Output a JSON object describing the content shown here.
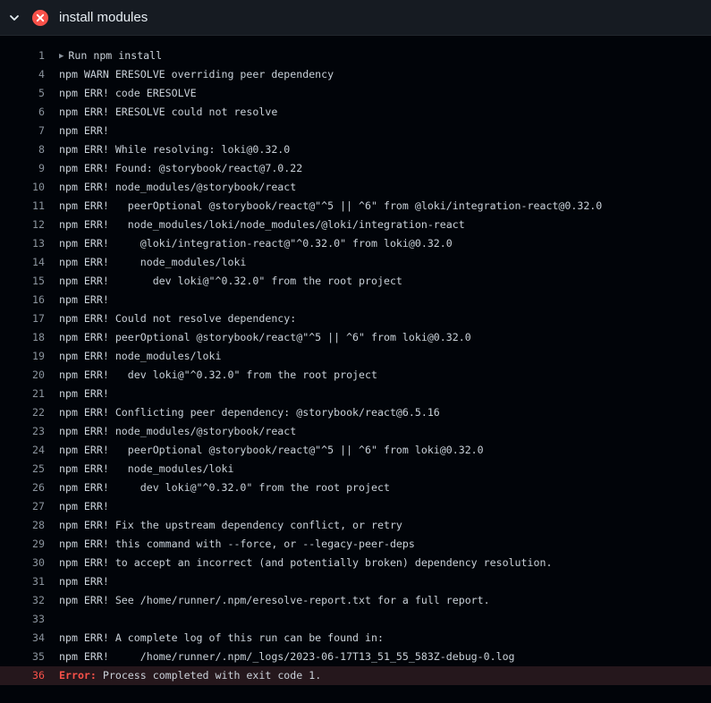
{
  "step": {
    "title": "install modules",
    "status": "failed",
    "icons": {
      "toggle": "chevron-down-icon",
      "status": "x-circle-fill-icon"
    },
    "colors": {
      "failure": "#f85149",
      "background": "#010409",
      "header": "#161b22"
    }
  },
  "log": {
    "lines": [
      {
        "num": "1",
        "text": "Run npm install",
        "group": true
      },
      {
        "num": "4",
        "text": "npm WARN ERESOLVE overriding peer dependency"
      },
      {
        "num": "5",
        "text": "npm ERR! code ERESOLVE"
      },
      {
        "num": "6",
        "text": "npm ERR! ERESOLVE could not resolve"
      },
      {
        "num": "7",
        "text": "npm ERR!"
      },
      {
        "num": "8",
        "text": "npm ERR! While resolving: loki@0.32.0"
      },
      {
        "num": "9",
        "text": "npm ERR! Found: @storybook/react@7.0.22"
      },
      {
        "num": "10",
        "text": "npm ERR! node_modules/@storybook/react"
      },
      {
        "num": "11",
        "text": "npm ERR!   peerOptional @storybook/react@\"^5 || ^6\" from @loki/integration-react@0.32.0"
      },
      {
        "num": "12",
        "text": "npm ERR!   node_modules/loki/node_modules/@loki/integration-react"
      },
      {
        "num": "13",
        "text": "npm ERR!     @loki/integration-react@\"^0.32.0\" from loki@0.32.0"
      },
      {
        "num": "14",
        "text": "npm ERR!     node_modules/loki"
      },
      {
        "num": "15",
        "text": "npm ERR!       dev loki@\"^0.32.0\" from the root project"
      },
      {
        "num": "16",
        "text": "npm ERR!"
      },
      {
        "num": "17",
        "text": "npm ERR! Could not resolve dependency:"
      },
      {
        "num": "18",
        "text": "npm ERR! peerOptional @storybook/react@\"^5 || ^6\" from loki@0.32.0"
      },
      {
        "num": "19",
        "text": "npm ERR! node_modules/loki"
      },
      {
        "num": "20",
        "text": "npm ERR!   dev loki@\"^0.32.0\" from the root project"
      },
      {
        "num": "21",
        "text": "npm ERR!"
      },
      {
        "num": "22",
        "text": "npm ERR! Conflicting peer dependency: @storybook/react@6.5.16"
      },
      {
        "num": "23",
        "text": "npm ERR! node_modules/@storybook/react"
      },
      {
        "num": "24",
        "text": "npm ERR!   peerOptional @storybook/react@\"^5 || ^6\" from loki@0.32.0"
      },
      {
        "num": "25",
        "text": "npm ERR!   node_modules/loki"
      },
      {
        "num": "26",
        "text": "npm ERR!     dev loki@\"^0.32.0\" from the root project"
      },
      {
        "num": "27",
        "text": "npm ERR!"
      },
      {
        "num": "28",
        "text": "npm ERR! Fix the upstream dependency conflict, or retry"
      },
      {
        "num": "29",
        "text": "npm ERR! this command with --force, or --legacy-peer-deps"
      },
      {
        "num": "30",
        "text": "npm ERR! to accept an incorrect (and potentially broken) dependency resolution."
      },
      {
        "num": "31",
        "text": "npm ERR!"
      },
      {
        "num": "32",
        "text": "npm ERR! See /home/runner/.npm/eresolve-report.txt for a full report."
      },
      {
        "num": "33",
        "text": ""
      },
      {
        "num": "34",
        "text": "npm ERR! A complete log of this run can be found in:"
      },
      {
        "num": "35",
        "text": "npm ERR!     /home/runner/.npm/_logs/2023-06-17T13_51_55_583Z-debug-0.log"
      },
      {
        "num": "36",
        "text": "Process completed with exit code 1.",
        "error": true,
        "error_label": "Error:"
      }
    ]
  }
}
